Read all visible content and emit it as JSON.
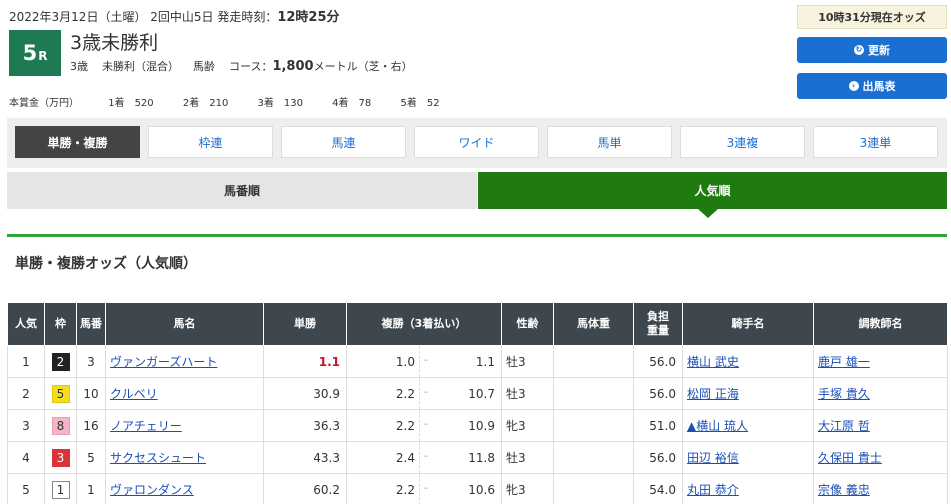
{
  "race": {
    "date": "2022年3月12日（土曜） 2回中山5日 発走時刻：",
    "post_time": "12時25分",
    "number": "5",
    "number_suffix": "R",
    "title": "3歳未勝利",
    "class": "3歳",
    "condition": "未勝利（混合）",
    "weight_rule": "馬齢",
    "course_label": "コース：",
    "distance": "1,800",
    "distance_unit": "メートル（芝・右）"
  },
  "prize": {
    "label": "本賞金（万円）",
    "items": [
      {
        "place": "1着",
        "amount": "520"
      },
      {
        "place": "2着",
        "amount": "210"
      },
      {
        "place": "3着",
        "amount": "130"
      },
      {
        "place": "4着",
        "amount": "78"
      },
      {
        "place": "5着",
        "amount": "52"
      }
    ]
  },
  "sidebar": {
    "odds_time": "10時31分現在オッズ",
    "refresh_label": "更新",
    "entries_label": "出馬表"
  },
  "tabs": [
    "単勝・複勝",
    "枠連",
    "馬連",
    "ワイド",
    "馬単",
    "3連複",
    "3連単"
  ],
  "sort": {
    "by_number": "馬番順",
    "by_popularity": "人気順"
  },
  "section_title": "単勝・複勝オッズ（人気順）",
  "table": {
    "headers": {
      "rank": "人気",
      "waku": "枠",
      "umaban": "馬番",
      "horse": "馬名",
      "win": "単勝",
      "place": "複勝（3着払い）",
      "sex_age": "性齢",
      "body_weight": "馬体重",
      "burden_1": "負担",
      "burden_2": "重量",
      "jockey": "騎手名",
      "trainer": "調教師名"
    },
    "rows": [
      {
        "rank": "1",
        "waku": "2",
        "umaban": "3",
        "horse": "ヴァンガーズハート",
        "win": "1.1",
        "place_min": "1.0",
        "place_max": "1.1",
        "sex_age": "牡3",
        "body_weight": "",
        "burden": "56.0",
        "jockey": "横山 武史",
        "trainer": "鹿戸 雄一"
      },
      {
        "rank": "2",
        "waku": "5",
        "umaban": "10",
        "horse": "クルベリ",
        "win": "30.9",
        "place_min": "2.2",
        "place_max": "10.7",
        "sex_age": "牡3",
        "body_weight": "",
        "burden": "56.0",
        "jockey": "松岡 正海",
        "trainer": "手塚 貴久"
      },
      {
        "rank": "3",
        "waku": "8",
        "umaban": "16",
        "horse": "ノアチェリー",
        "win": "36.3",
        "place_min": "2.2",
        "place_max": "10.9",
        "sex_age": "牝3",
        "body_weight": "",
        "burden": "51.0",
        "jockey": "▲横山 琉人",
        "trainer": "大江原 哲"
      },
      {
        "rank": "4",
        "waku": "3",
        "umaban": "5",
        "horse": "サクセスシュート",
        "win": "43.3",
        "place_min": "2.4",
        "place_max": "11.8",
        "sex_age": "牡3",
        "body_weight": "",
        "burden": "56.0",
        "jockey": "田辺 裕信",
        "trainer": "久保田 貴士"
      },
      {
        "rank": "5",
        "waku": "1",
        "umaban": "1",
        "horse": "ヴァロンダンス",
        "win": "60.2",
        "place_min": "2.2",
        "place_max": "10.6",
        "sex_age": "牝3",
        "body_weight": "",
        "burden": "54.0",
        "jockey": "丸田 恭介",
        "trainer": "宗像 義忠"
      }
    ]
  },
  "colors": {
    "race_badge": "#1e7a53",
    "active_sort": "#1f7a0f",
    "button_blue": "#1a6fd1",
    "table_header": "#3d474d",
    "favorite_odds": "#c5132b"
  }
}
